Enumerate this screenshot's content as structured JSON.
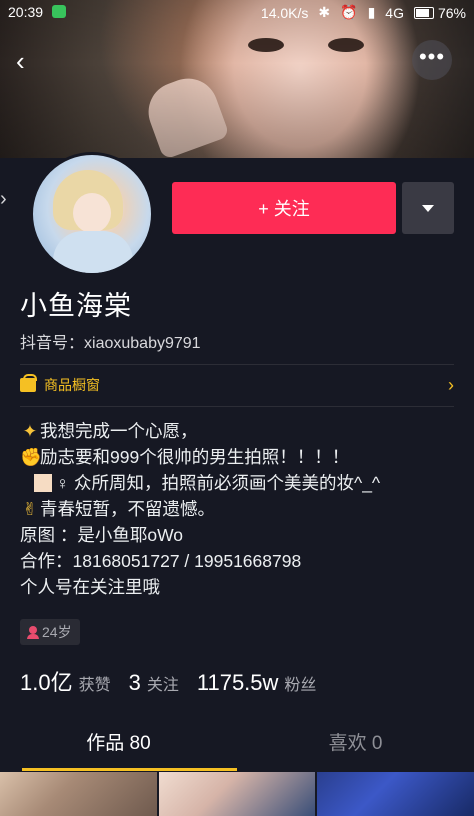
{
  "status_bar": {
    "time": "20:39",
    "network_speed": "14.0K/s",
    "network_type": "4G",
    "battery": "76%"
  },
  "header": {
    "back_icon": "chevron-left-icon",
    "more_icon": "more-dots-icon"
  },
  "profile": {
    "follow_label": "+ 关注",
    "name": "小鱼海棠",
    "id_label": "抖音号：",
    "id_value": "xiaoxubaby9791",
    "shop_label": "商品橱窗",
    "bio_lines": [
      "我想完成一个心愿，",
      "励志要和999个很帅的男生拍照！！！！",
      "♀ 众所周知，拍照前必须画个美美的妆^_^",
      "青春短暂，不留遗憾。",
      "原图    ：是小鱼耶oWo",
      "合作：18168051727 / 19951668798",
      "个人号在关注里哦"
    ],
    "age_tag": "24岁"
  },
  "stats": {
    "likes_num": "1.0亿",
    "likes_label": "获赞",
    "following_num": "3",
    "following_label": "关注",
    "followers_num": "1175.5w",
    "followers_label": "粉丝"
  },
  "tabs": {
    "works": "作品 80",
    "likes": "喜欢 0"
  },
  "colors": {
    "background": "#161823",
    "follow_button": "#fe2c55",
    "accent_yellow": "#f5c023"
  }
}
